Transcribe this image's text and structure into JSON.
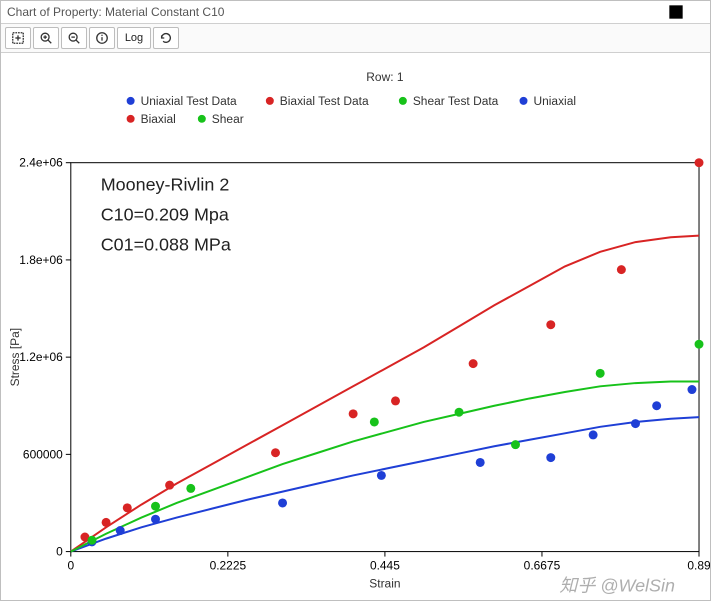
{
  "window": {
    "title": "Chart of Property: Material Constant C10"
  },
  "toolbar": {
    "fit_tip": "Fit",
    "zoom_in_tip": "Zoom In",
    "zoom_out_tip": "Zoom Out",
    "info_tip": "Info",
    "log_label": "Log",
    "refresh_tip": "Refresh"
  },
  "header": {
    "row_label": "Row: 1"
  },
  "legend": {
    "items": [
      {
        "label": "Uniaxial Test Data",
        "color": "#1f3fd6",
        "kind": "point"
      },
      {
        "label": "Biaxial Test Data",
        "color": "#d82424",
        "kind": "point"
      },
      {
        "label": "Shear Test Data",
        "color": "#17c21a",
        "kind": "point"
      },
      {
        "label": "Uniaxial",
        "color": "#1f3fd6",
        "kind": "line"
      },
      {
        "label": "Biaxial",
        "color": "#d82424",
        "kind": "line"
      },
      {
        "label": "Shear",
        "color": "#17c21a",
        "kind": "line"
      }
    ]
  },
  "annotation": {
    "line1": "Mooney-Rivlin 2",
    "line2": "C10=0.209 Mpa",
    "line3": "C01=0.088 MPa"
  },
  "watermark": "知乎 @WelSin",
  "chart_data": {
    "type": "scatter+line",
    "xlabel": "Strain",
    "ylabel": "Stress [Pa]",
    "xlim": [
      0,
      0.89
    ],
    "ylim": [
      0,
      2400000.0
    ],
    "xticks": [
      0,
      0.2225,
      0.445,
      0.6675,
      0.89
    ],
    "yticks": [
      0,
      600000,
      1200000.0,
      1800000.0,
      2400000.0
    ],
    "ytick_labels": [
      "0",
      "600000",
      "1.2e+06",
      "1.8e+06",
      "2.4e+06"
    ],
    "series_points": [
      {
        "name": "Uniaxial Test Data",
        "color": "#1f3fd6",
        "points": [
          [
            0.03,
            60000
          ],
          [
            0.07,
            130000
          ],
          [
            0.12,
            200000
          ],
          [
            0.3,
            300000
          ],
          [
            0.44,
            470000
          ],
          [
            0.58,
            550000
          ],
          [
            0.68,
            580000
          ],
          [
            0.74,
            720000
          ],
          [
            0.8,
            790000
          ],
          [
            0.83,
            900000
          ],
          [
            0.88,
            1000000
          ]
        ]
      },
      {
        "name": "Biaxial Test Data",
        "color": "#d82424",
        "points": [
          [
            0.02,
            90000
          ],
          [
            0.05,
            180000
          ],
          [
            0.08,
            270000
          ],
          [
            0.14,
            410000
          ],
          [
            0.29,
            610000
          ],
          [
            0.4,
            850000
          ],
          [
            0.46,
            930000
          ],
          [
            0.57,
            1160000
          ],
          [
            0.68,
            1400000
          ],
          [
            0.78,
            1740000
          ],
          [
            0.89,
            2400000
          ]
        ]
      },
      {
        "name": "Shear Test Data",
        "color": "#17c21a",
        "points": [
          [
            0.03,
            70000
          ],
          [
            0.12,
            280000
          ],
          [
            0.17,
            390000
          ],
          [
            0.43,
            800000
          ],
          [
            0.55,
            860000
          ],
          [
            0.63,
            660000
          ],
          [
            0.75,
            1100000
          ],
          [
            0.89,
            1280000
          ]
        ]
      }
    ],
    "series_lines": [
      {
        "name": "Uniaxial",
        "color": "#1f3fd6",
        "points": [
          [
            0,
            0
          ],
          [
            0.05,
            80000
          ],
          [
            0.1,
            150000
          ],
          [
            0.15,
            210000
          ],
          [
            0.2,
            265000
          ],
          [
            0.25,
            320000
          ],
          [
            0.3,
            370000
          ],
          [
            0.35,
            420000
          ],
          [
            0.4,
            470000
          ],
          [
            0.45,
            515000
          ],
          [
            0.5,
            560000
          ],
          [
            0.55,
            605000
          ],
          [
            0.6,
            650000
          ],
          [
            0.65,
            690000
          ],
          [
            0.7,
            730000
          ],
          [
            0.75,
            770000
          ],
          [
            0.8,
            800000
          ],
          [
            0.85,
            820000
          ],
          [
            0.89,
            830000
          ]
        ]
      },
      {
        "name": "Biaxial",
        "color": "#d82424",
        "points": [
          [
            0,
            0
          ],
          [
            0.05,
            150000
          ],
          [
            0.1,
            290000
          ],
          [
            0.15,
            420000
          ],
          [
            0.2,
            540000
          ],
          [
            0.25,
            660000
          ],
          [
            0.3,
            780000
          ],
          [
            0.35,
            900000
          ],
          [
            0.4,
            1020000
          ],
          [
            0.45,
            1140000
          ],
          [
            0.5,
            1260000
          ],
          [
            0.55,
            1390000
          ],
          [
            0.6,
            1520000
          ],
          [
            0.65,
            1640000
          ],
          [
            0.7,
            1760000
          ],
          [
            0.75,
            1850000
          ],
          [
            0.8,
            1910000
          ],
          [
            0.85,
            1940000
          ],
          [
            0.89,
            1950000
          ]
        ]
      },
      {
        "name": "Shear",
        "color": "#17c21a",
        "points": [
          [
            0,
            0
          ],
          [
            0.05,
            110000
          ],
          [
            0.1,
            210000
          ],
          [
            0.15,
            300000
          ],
          [
            0.2,
            380000
          ],
          [
            0.25,
            460000
          ],
          [
            0.3,
            540000
          ],
          [
            0.35,
            610000
          ],
          [
            0.4,
            680000
          ],
          [
            0.45,
            740000
          ],
          [
            0.5,
            800000
          ],
          [
            0.55,
            850000
          ],
          [
            0.6,
            900000
          ],
          [
            0.65,
            945000
          ],
          [
            0.7,
            985000
          ],
          [
            0.75,
            1020000
          ],
          [
            0.8,
            1040000
          ],
          [
            0.85,
            1050000
          ],
          [
            0.89,
            1050000
          ]
        ]
      }
    ]
  }
}
